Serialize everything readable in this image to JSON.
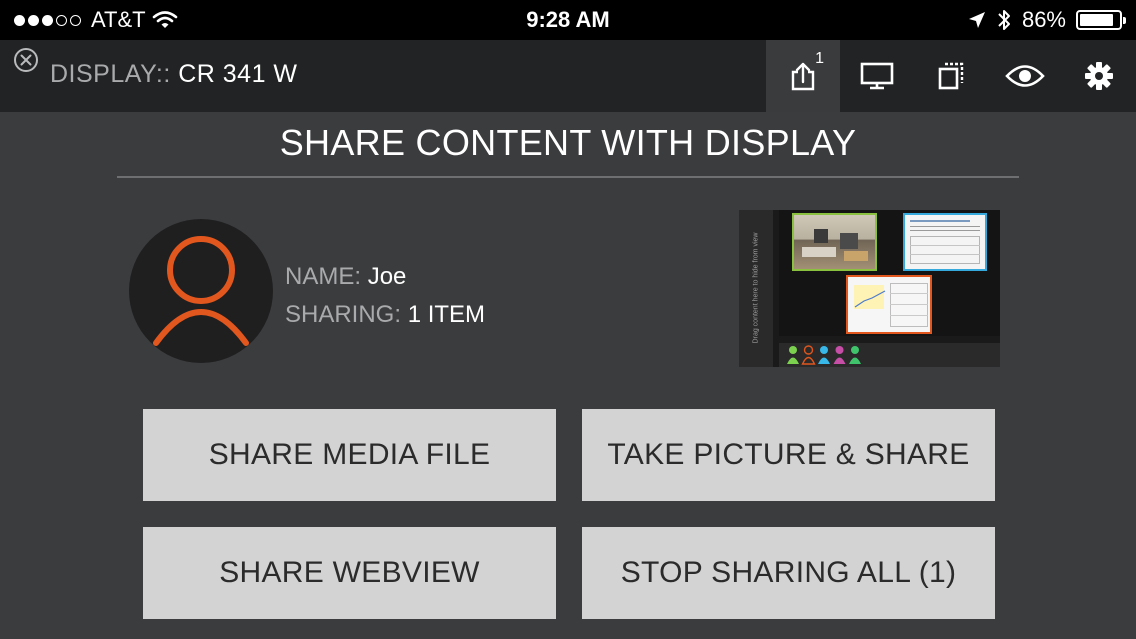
{
  "status_bar": {
    "carrier": "AT&T",
    "time": "9:28 AM",
    "battery_percent": "86%",
    "signal_bars_filled": 3,
    "signal_bars_total": 5,
    "battery_level": 0.86,
    "icons": [
      "wifi-icon",
      "location-arrow-icon",
      "bluetooth-icon",
      "battery-icon"
    ]
  },
  "nav": {
    "display_label": "DISPLAY::",
    "display_name": "CR 341 W",
    "share_badge": "1",
    "icons": [
      "close-icon",
      "share-icon",
      "monitor-icon",
      "layers-icon",
      "eye-icon",
      "gear-icon"
    ]
  },
  "main": {
    "heading": "SHARE CONTENT WITH DISPLAY",
    "user": {
      "name_label": "NAME:",
      "name_value": "Joe",
      "sharing_label": "SHARING:",
      "sharing_value": "1 ITEM"
    },
    "preview": {
      "side_text": "Drag content here to hide from view",
      "participant_colors": [
        "#7cd14f",
        "#e0561c",
        "#37b8e8",
        "#c74ea7",
        "#3fc46c"
      ]
    }
  },
  "actions": {
    "share_media": "SHARE MEDIA FILE",
    "take_picture": "TAKE PICTURE & SHARE",
    "share_webview": "SHARE WEBVIEW",
    "stop_sharing": "STOP SHARING ALL (1)"
  },
  "colors": {
    "accent": "#e2571e",
    "background": "#3b3c3e",
    "navbar": "#222324",
    "button": "#d3d3d4"
  }
}
